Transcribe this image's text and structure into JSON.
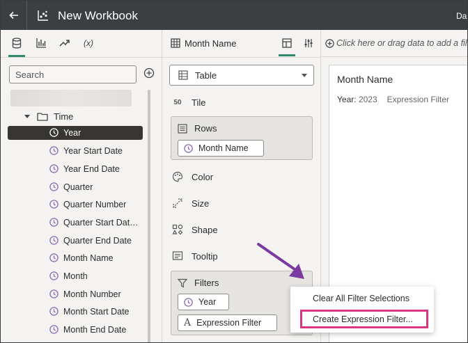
{
  "header": {
    "title": "New Workbook",
    "right_text": "Da"
  },
  "left_panel": {
    "search_placeholder": "Search",
    "folder_label": "Time",
    "items": [
      {
        "label": "Year",
        "selected": true
      },
      {
        "label": "Year Start Date"
      },
      {
        "label": "Year End Date"
      },
      {
        "label": "Quarter"
      },
      {
        "label": "Quarter Number"
      },
      {
        "label": "Quarter Start Dat…"
      },
      {
        "label": "Quarter End Date"
      },
      {
        "label": "Month Name"
      },
      {
        "label": "Month"
      },
      {
        "label": "Month Number"
      },
      {
        "label": "Month Start Date"
      },
      {
        "label": "Month End Date"
      }
    ]
  },
  "grammar": {
    "viz_name": "Month Name",
    "viz_type": "Table",
    "tile_label": "Tile",
    "rows_label": "Rows",
    "rows_pill": "Month Name",
    "color_label": "Color",
    "size_label": "Size",
    "shape_label": "Shape",
    "tooltip_label": "Tooltip",
    "filters_label": "Filters",
    "filter_pill_1": "Year",
    "filter_pill_2": "Expression Filter"
  },
  "canvas": {
    "drop_hint": "Click here or drag data to add a fil",
    "viz_title": "Month Name",
    "filter_key": "Year:",
    "filter_value": "2023",
    "filter_expr": "Expression Filter"
  },
  "context_menu": {
    "item_1": "Clear All Filter Selections",
    "item_2": "Create Expression Filter..."
  },
  "colors": {
    "header_bg": "#3c3f41",
    "accent": "#2f8a6d",
    "highlight": "#d8377f",
    "arrow": "#7b3aa0",
    "clock_icon": "#8b6bb5"
  }
}
